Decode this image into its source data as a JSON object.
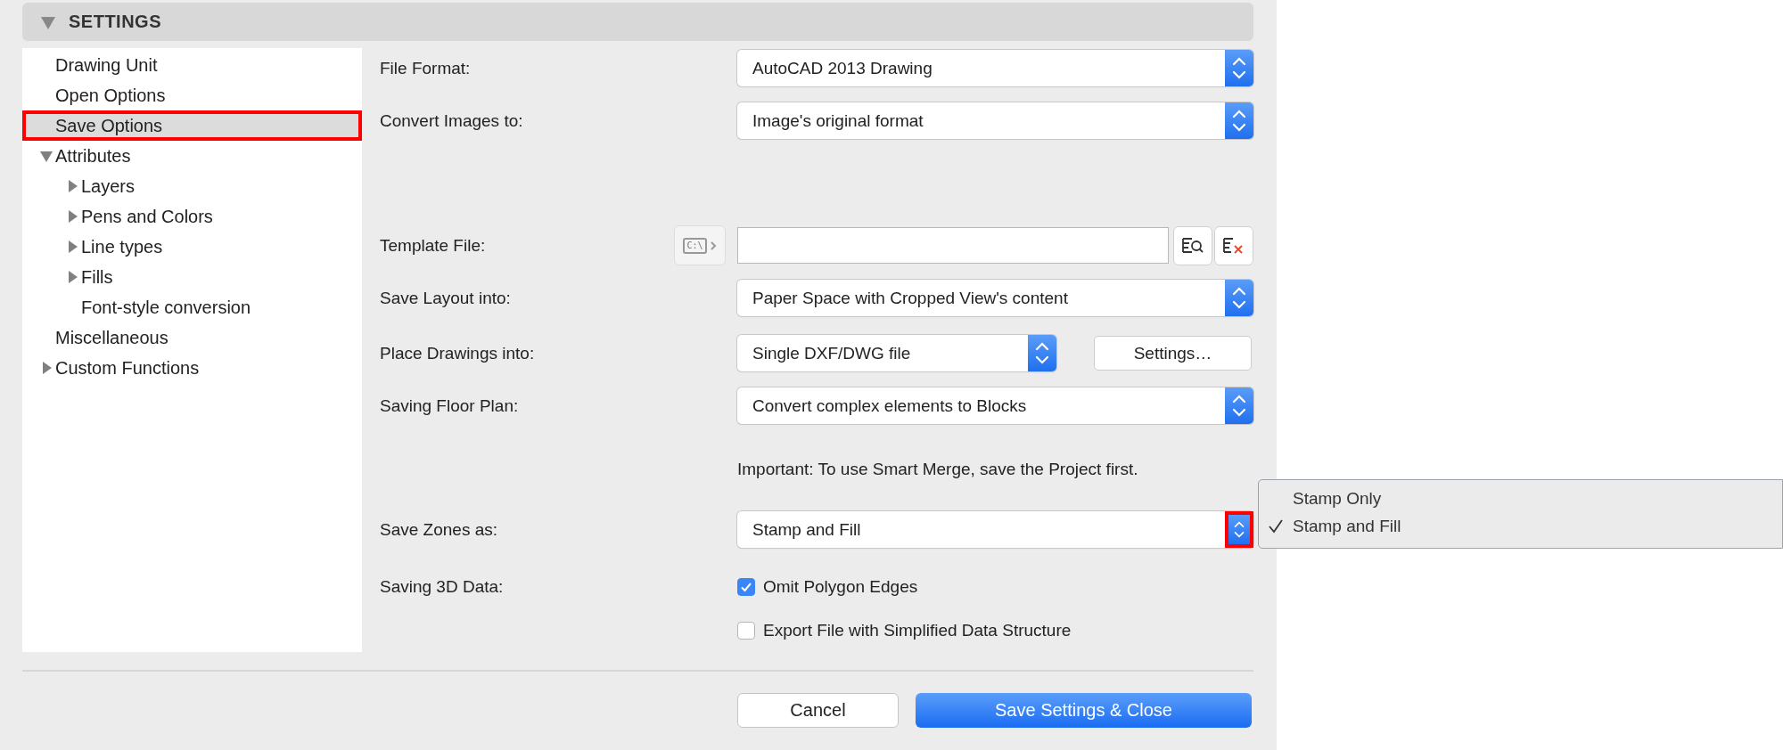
{
  "header": {
    "title": "SETTINGS",
    "expanded": true
  },
  "sidebar": {
    "items": [
      {
        "label": "Drawing Unit",
        "selected": false
      },
      {
        "label": "Open Options",
        "selected": false
      },
      {
        "label": "Save Options",
        "selected": true,
        "highlighted": true
      },
      {
        "label": "Attributes",
        "selected": false,
        "expanded": true,
        "children": [
          {
            "label": "Layers",
            "selected": false,
            "expanded": false
          },
          {
            "label": "Pens and Colors",
            "selected": false,
            "expanded": false
          },
          {
            "label": "Line types",
            "selected": false,
            "expanded": false
          },
          {
            "label": "Fills",
            "selected": false,
            "expanded": false
          },
          {
            "label": "Font-style conversion",
            "selected": false
          }
        ]
      },
      {
        "label": "Miscellaneous",
        "selected": false
      },
      {
        "label": "Custom Functions",
        "selected": false,
        "expanded": false
      }
    ]
  },
  "form": {
    "rows": [
      {
        "kind": "popup",
        "label": "File Format:",
        "value": "AutoCAD 2013 Drawing"
      },
      {
        "kind": "popup",
        "label": "Convert Images to:",
        "value": "Image's original format"
      },
      {
        "kind": "file",
        "label": "Template File:",
        "path_label": "C:\\"
      },
      {
        "kind": "popup",
        "label": "Save Layout into:",
        "value": "Paper Space with Cropped View's content"
      },
      {
        "kind": "popup_button",
        "label": "Place Drawings into:",
        "value": "Single DXF/DWG file",
        "button": "Settings…"
      },
      {
        "kind": "popup",
        "label": "Saving Floor Plan:",
        "value": "Convert complex elements to Blocks"
      },
      {
        "kind": "note",
        "text": "Important: To use Smart Merge, save the Project first."
      },
      {
        "kind": "popup",
        "label": "Save Zones as:",
        "value": "Stamp and Fill",
        "highlighted": true,
        "menu": [
          {
            "label": "Stamp Only",
            "selected": false
          },
          {
            "label": "Stamp and Fill",
            "selected": true
          }
        ]
      },
      {
        "kind": "checkbox",
        "label": "Saving 3D Data:",
        "text": "Omit Polygon Edges",
        "checked": true
      },
      {
        "kind": "checkbox",
        "text": "Export File with Simplified Data Structure",
        "checked": false
      }
    ]
  },
  "buttons": [
    {
      "label": "Cancel",
      "kind": "default"
    },
    {
      "label": "Save Settings & Close",
      "kind": "primary"
    }
  ]
}
